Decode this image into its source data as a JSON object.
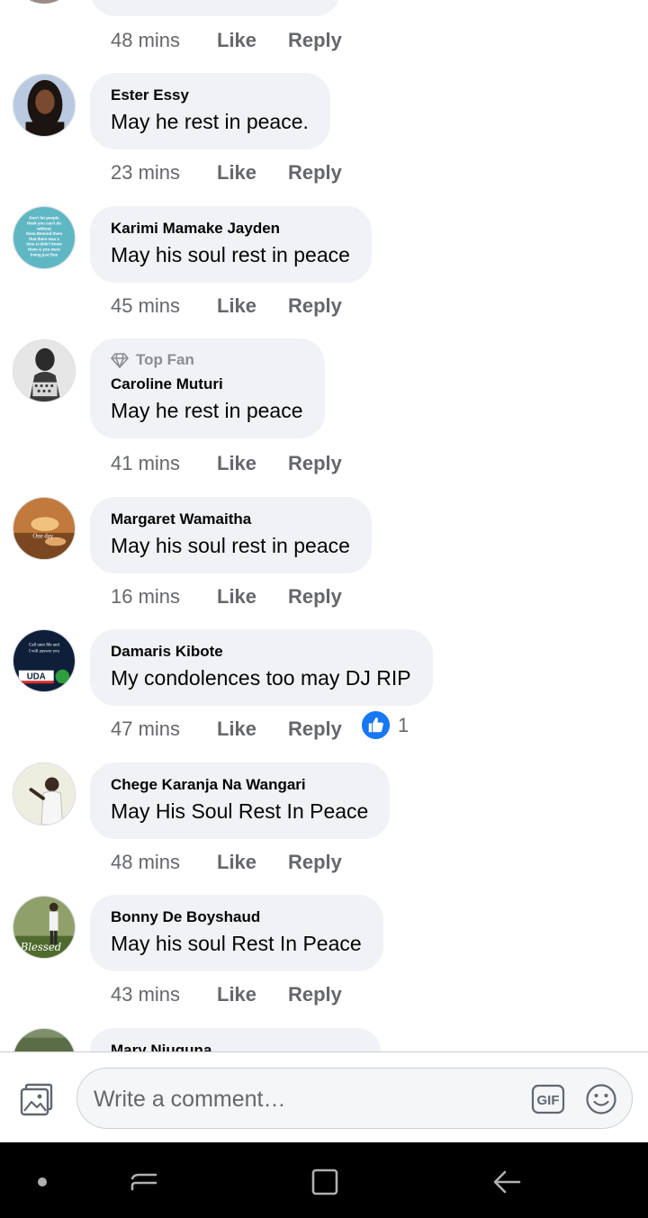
{
  "comments": [
    {
      "author": "Ester Essy",
      "text": "May he rest in peace.",
      "time": "23 mins",
      "like": "Like",
      "reply": "Reply"
    },
    {
      "author": "Karimi Mamake Jayden",
      "text": "May his soul rest in peace",
      "time": "45 mins",
      "like": "Like",
      "reply": "Reply",
      "avatar_text": [
        "Don't let people",
        "think you can't do",
        "without",
        "them.Remind them",
        "that there was a",
        "time U didn't know",
        "them & you were",
        "living just fine"
      ]
    },
    {
      "badge": "Top Fan",
      "author": "Caroline Muturi",
      "text": "May he rest in peace",
      "time": "41 mins",
      "like": "Like",
      "reply": "Reply"
    },
    {
      "author": "Margaret Wamaitha",
      "text": "May his soul rest in peace",
      "time": "16 mins",
      "like": "Like",
      "reply": "Reply",
      "avatar_text": [
        "One day"
      ]
    },
    {
      "author": "Damaris Kibote",
      "text": "My condolences too may DJ RIP",
      "time": "47 mins",
      "like": "Like",
      "reply": "Reply",
      "reaction_count": "1",
      "avatar_text": [
        "Call unto Me and",
        "I will answer you",
        "UDA"
      ]
    },
    {
      "author": "Chege Karanja Na Wangari",
      "text": "May His Soul Rest In Peace",
      "time": "48 mins",
      "like": "Like",
      "reply": "Reply"
    },
    {
      "author": "Bonny De Boyshaud",
      "text": "May his soul Rest In Peace",
      "time": "43 mins",
      "like": "Like",
      "reply": "Reply",
      "avatar_text": [
        "Blessed"
      ]
    },
    {
      "author": "Mary Njuguna"
    }
  ],
  "previous_meta": {
    "time": "48 mins",
    "like": "Like",
    "reply": "Reply"
  },
  "composer": {
    "placeholder": "Write a comment…",
    "gif_label": "GIF"
  },
  "colors": {
    "bubble": "#f0f2f5",
    "meta_text": "#65676b",
    "like_blue": "#1877f2",
    "navbar": "#000000"
  },
  "icons": [
    "photo-icon",
    "gif-icon",
    "emoji-icon",
    "diamond-icon",
    "like-reaction-icon",
    "nav-dot-icon",
    "recents-icon",
    "home-icon",
    "back-icon"
  ]
}
